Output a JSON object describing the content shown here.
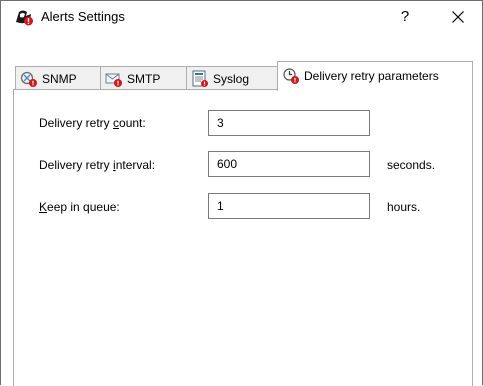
{
  "window": {
    "title": "Alerts Settings",
    "help_label": "?",
    "icon": "alerts-app-icon",
    "close_icon": "close-icon"
  },
  "tabs": [
    {
      "label": "SNMP",
      "icon": "snmp-icon",
      "active": false
    },
    {
      "label": "SMTP",
      "icon": "smtp-mail-icon",
      "active": false
    },
    {
      "label": "Syslog",
      "icon": "syslog-icon",
      "active": false
    },
    {
      "label": "Delivery retry parameters",
      "icon": "delivery-retry-clock-icon",
      "active": true
    }
  ],
  "form": {
    "retry_count": {
      "label_pre": "Delivery retry ",
      "label_accel": "c",
      "label_post": "ount:",
      "value": "3"
    },
    "retry_interval": {
      "label_pre": "Delivery retry ",
      "label_accel": "i",
      "label_post": "nterval:",
      "value": "600",
      "unit": "seconds."
    },
    "keep_in_queue": {
      "label_pre": "",
      "label_accel": "K",
      "label_post": "eep in queue:",
      "value": "1",
      "unit": "hours."
    }
  }
}
